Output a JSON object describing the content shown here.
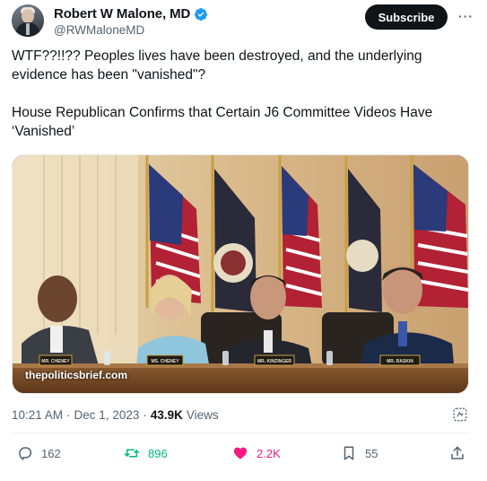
{
  "author": {
    "display_name": "Robert W Malone, MD",
    "handle": "@RWMaloneMD",
    "verified_icon": "verified-badge-icon"
  },
  "header": {
    "subscribe_label": "Subscribe",
    "more_label": "···"
  },
  "tweet": {
    "paragraph_1": "WTF??!!??  Peoples lives have been destroyed, and the underlying evidence has been \"vanished\"?",
    "paragraph_2": "House Republican Confirms that Certain J6 Committee Videos Have ‘Vanished’"
  },
  "media": {
    "watermark": "thepoliticsbrief.com",
    "nameplates": [
      "MR. CHENEY",
      "MS. CHENEY",
      "MR. KINZINGER",
      "MR. RASKIN"
    ]
  },
  "meta": {
    "time": "10:21 AM",
    "separator": "·",
    "date": "Dec 1, 2023",
    "views_count": "43.9K",
    "views_label": "Views"
  },
  "actions": {
    "replies": "162",
    "reposts": "896",
    "likes": "2.2K",
    "bookmarks": "55"
  },
  "colors": {
    "text": "#0f1419",
    "secondary": "#536471",
    "verified": "#1d9bf0",
    "repost_active": "#00ba7c",
    "like_active": "#f91880"
  }
}
